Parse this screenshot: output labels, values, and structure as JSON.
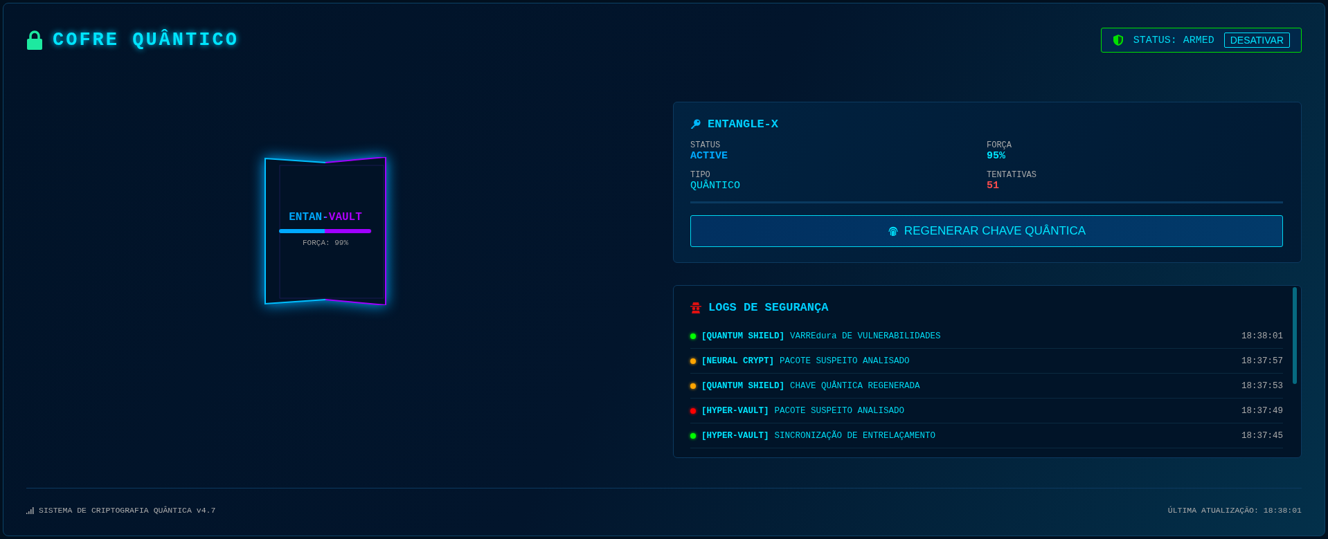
{
  "header": {
    "title": "COFRE QUÂNTICO",
    "status": {
      "label": "STATUS: ARMED",
      "armed": true,
      "button": "DESATIVAR"
    }
  },
  "vault": {
    "title": "ENTAN-VAULT",
    "level": 0.99,
    "strength": "FORÇA: 99%"
  },
  "key_card": {
    "title": "ENTANGLE-X",
    "fields": [
      {
        "label": "STATUS",
        "value": "ACTIVE",
        "color": "#00aaff"
      },
      {
        "label": "FORÇA",
        "value": "95%",
        "color": "#00e5ff"
      },
      {
        "label": "TIPO",
        "value": "QUÂNTICO",
        "color": "#00e5ff"
      },
      {
        "label": "TENTATIVAS",
        "value": "51",
        "color": "#ff4d4d"
      }
    ],
    "button": "REGENERAR CHAVE QUÂNTICA"
  },
  "logs": {
    "title": "LOGS DE SEGURANÇA",
    "entries": [
      {
        "source": "[QUANTUM SHIELD]",
        "message": "VARREdura DE VULNERABILIDADES",
        "time": "18:38:01",
        "color": "#00ff00"
      },
      {
        "source": "[NEURAL CRYPT]",
        "message": "PACOTE SUSPEITO ANALISADO",
        "time": "18:37:57",
        "color": "#ffa500"
      },
      {
        "source": "[QUANTUM SHIELD]",
        "message": "CHAVE QUÂNTICA REGENERADA",
        "time": "18:37:53",
        "color": "#ffa500"
      },
      {
        "source": "[HYPER-VAULT]",
        "message": "PACOTE SUSPEITO ANALISADO",
        "time": "18:37:49",
        "color": "#ff0000"
      },
      {
        "source": "[HYPER-VAULT]",
        "message": "SINCRONIZAÇÃO DE ENTRELAÇAMENTO",
        "time": "18:37:45",
        "color": "#00ff00"
      }
    ]
  },
  "footer": {
    "system": "SISTEMA DE CRIPTOGRAFIA QUÂNTICA v4.7",
    "updated": "ÚLTIMA ATUALIZAÇÃO: 18:38:01"
  }
}
